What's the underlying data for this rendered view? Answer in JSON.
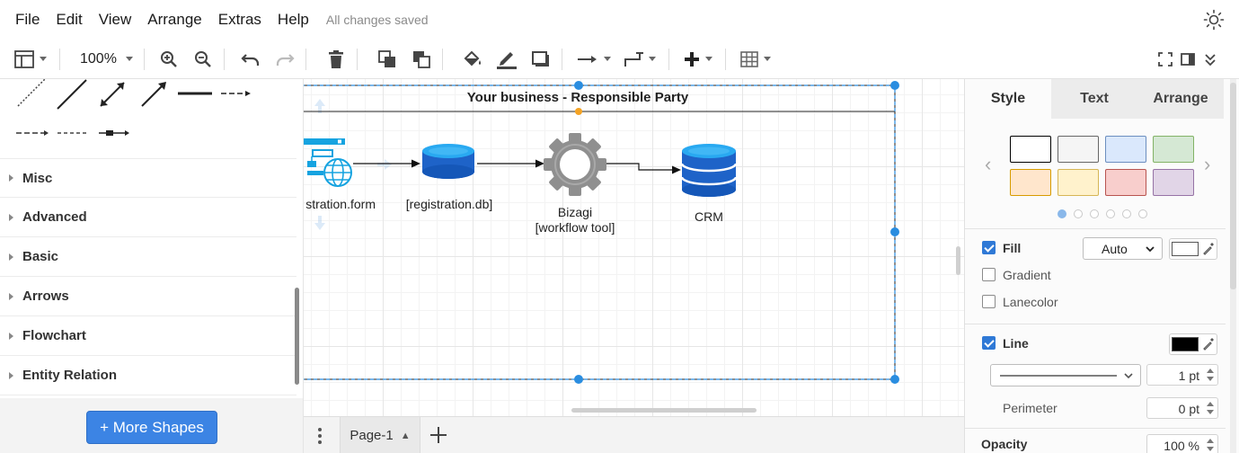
{
  "menu": {
    "items": [
      "File",
      "Edit",
      "View",
      "Arrange",
      "Extras",
      "Help"
    ],
    "save_status": "All changes saved"
  },
  "toolbar": {
    "zoom": "100%",
    "icons": [
      "sidebar-toggle-icon",
      "zoom-in-icon",
      "zoom-out-icon",
      "undo-icon",
      "redo-icon",
      "delete-icon",
      "to-front-icon",
      "to-back-icon",
      "fill-color-icon",
      "line-color-icon",
      "shadow-icon",
      "connection-icon",
      "waypoints-icon",
      "insert-icon",
      "table-icon",
      "fullscreen-icon",
      "format-panel-icon",
      "collapse-icon"
    ]
  },
  "sidebar": {
    "libraries": [
      "Misc",
      "Advanced",
      "Basic",
      "Arrows",
      "Flowchart",
      "Entity Relation"
    ],
    "more_shapes": "+ More Shapes"
  },
  "diagram": {
    "container_title": "Your business - Responsible Party",
    "nodes": [
      {
        "id": "form",
        "label": "stration.form",
        "icon": "web-form-icon"
      },
      {
        "id": "db",
        "label": "[registration.db]",
        "icon": "database-icon"
      },
      {
        "id": "bizagi",
        "label_line1": "Bizagi",
        "label_line2": "[workflow tool]",
        "icon": "gear-icon"
      },
      {
        "id": "crm",
        "label": "CRM",
        "icon": "database-stack-icon"
      }
    ],
    "colors": {
      "selection": "#2a8de0",
      "blue_dark": "#1565c0",
      "blue_light": "#4fc3f7",
      "gear": "#8e8e8e"
    }
  },
  "pages": {
    "current": "Page-1"
  },
  "format_panel": {
    "tabs": [
      "Style",
      "Text",
      "Arrange"
    ],
    "active_tab": "Style",
    "swatches": [
      {
        "fill": "#ffffff",
        "stroke": "#000000"
      },
      {
        "fill": "#f5f5f5",
        "stroke": "#666666"
      },
      {
        "fill": "#dae8fc",
        "stroke": "#6c8ebf"
      },
      {
        "fill": "#d5e8d4",
        "stroke": "#82b366"
      },
      {
        "fill": "#ffe6cc",
        "stroke": "#d79b00"
      },
      {
        "fill": "#fff2cc",
        "stroke": "#d6b656"
      },
      {
        "fill": "#f8cecc",
        "stroke": "#b85450"
      },
      {
        "fill": "#e1d5e7",
        "stroke": "#9673a6"
      }
    ],
    "fill": {
      "label": "Fill",
      "checked": true,
      "mode": "Auto",
      "color": "#ffffff"
    },
    "gradient": {
      "label": "Gradient",
      "checked": false
    },
    "lanecolor": {
      "label": "Lanecolor",
      "checked": false
    },
    "line": {
      "label": "Line",
      "checked": true,
      "color": "#000000",
      "width": "1 pt"
    },
    "perimeter": {
      "label": "Perimeter",
      "value": "0 pt"
    },
    "opacity": {
      "label": "Opacity",
      "value": "100 %"
    }
  }
}
